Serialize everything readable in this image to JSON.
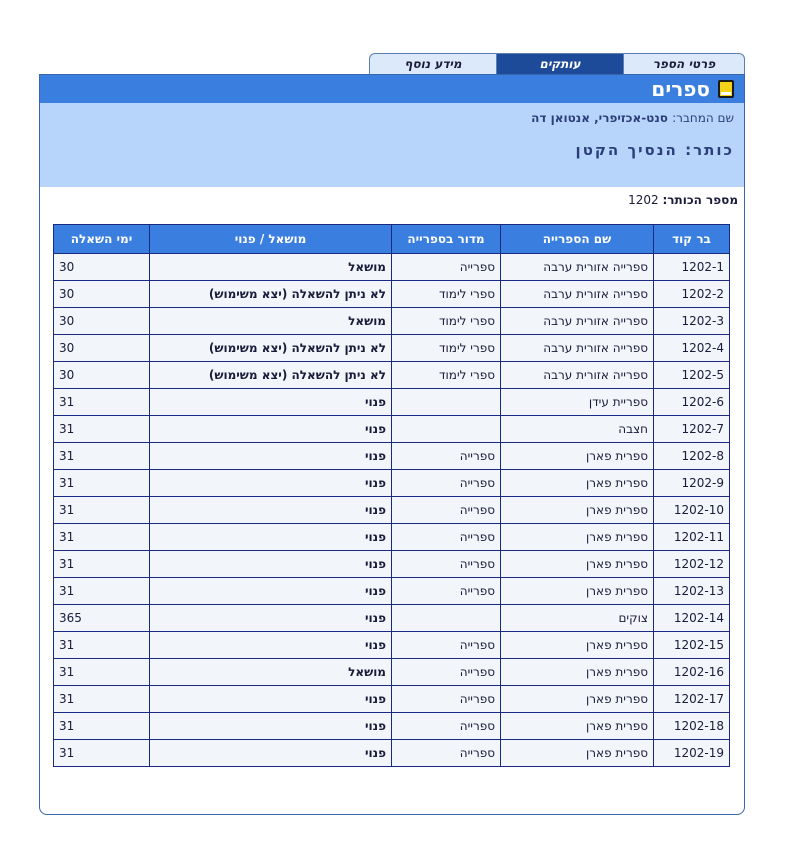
{
  "tabs": [
    {
      "label": "פרטי הספר",
      "active": false
    },
    {
      "label": "עותקים",
      "active": true
    },
    {
      "label": "מידע נוסף",
      "active": false
    }
  ],
  "panel": {
    "title": "ספרים",
    "icon": "book-icon",
    "author_label": "שם המחבר:",
    "author_value": "סנט-אכזיפרי, אנטואן דה",
    "title_label": "כותר:",
    "title_value": "הנסיך הקטן",
    "catalog_label": "מספר הכותר:",
    "catalog_value": "1202"
  },
  "table": {
    "headers": [
      "בר קוד",
      "שם הספרייה",
      "מדור בספרייה",
      "מושאל / פנוי",
      "ימי השאלה"
    ],
    "rows": [
      {
        "barcode": "1202-1",
        "library": "ספרייה אזורית ערבה",
        "section": "ספרייה",
        "status": "מושאל",
        "days": "30"
      },
      {
        "barcode": "1202-2",
        "library": "ספרייה אזורית ערבה",
        "section": "ספרי לימוד",
        "status": "לא ניתן להשאלה (יצא משימוש)",
        "days": "30"
      },
      {
        "barcode": "1202-3",
        "library": "ספרייה אזורית ערבה",
        "section": "ספרי לימוד",
        "status": "מושאל",
        "days": "30"
      },
      {
        "barcode": "1202-4",
        "library": "ספרייה אזורית ערבה",
        "section": "ספרי לימוד",
        "status": "לא ניתן להשאלה (יצא משימוש)",
        "days": "30"
      },
      {
        "barcode": "1202-5",
        "library": "ספרייה אזורית ערבה",
        "section": "ספרי לימוד",
        "status": "לא ניתן להשאלה (יצא משימוש)",
        "days": "30"
      },
      {
        "barcode": "1202-6",
        "library": "ספריית עידן",
        "section": "",
        "status": "פנוי",
        "days": "31"
      },
      {
        "barcode": "1202-7",
        "library": "חצבה",
        "section": "",
        "status": "פנוי",
        "days": "31"
      },
      {
        "barcode": "1202-8",
        "library": "ספרית פארן",
        "section": "ספרייה",
        "status": "פנוי",
        "days": "31"
      },
      {
        "barcode": "1202-9",
        "library": "ספרית פארן",
        "section": "ספרייה",
        "status": "פנוי",
        "days": "31"
      },
      {
        "barcode": "1202-10",
        "library": "ספרית פארן",
        "section": "ספרייה",
        "status": "פנוי",
        "days": "31"
      },
      {
        "barcode": "1202-11",
        "library": "ספרית פארן",
        "section": "ספרייה",
        "status": "פנוי",
        "days": "31"
      },
      {
        "barcode": "1202-12",
        "library": "ספרית פארן",
        "section": "ספרייה",
        "status": "פנוי",
        "days": "31"
      },
      {
        "barcode": "1202-13",
        "library": "ספרית פארן",
        "section": "ספרייה",
        "status": "פנוי",
        "days": "31"
      },
      {
        "barcode": "1202-14",
        "library": "צוקים",
        "section": "",
        "status": "פנוי",
        "days": "365"
      },
      {
        "barcode": "1202-15",
        "library": "ספרית פארן",
        "section": "ספרייה",
        "status": "פנוי",
        "days": "31"
      },
      {
        "barcode": "1202-16",
        "library": "ספרית פארן",
        "section": "ספרייה",
        "status": "מושאל",
        "days": "31"
      },
      {
        "barcode": "1202-17",
        "library": "ספרית פארן",
        "section": "ספרייה",
        "status": "פנוי",
        "days": "31"
      },
      {
        "barcode": "1202-18",
        "library": "ספרית פארן",
        "section": "ספרייה",
        "status": "פנוי",
        "days": "31"
      },
      {
        "barcode": "1202-19",
        "library": "ספרית פארן",
        "section": "ספרייה",
        "status": "פנוי",
        "days": "31"
      }
    ]
  },
  "colors": {
    "header_blue": "#3a7fe0",
    "info_bg": "#b7d5fb",
    "lent_red": "#e00000",
    "free_green": "#1a8a1a"
  }
}
